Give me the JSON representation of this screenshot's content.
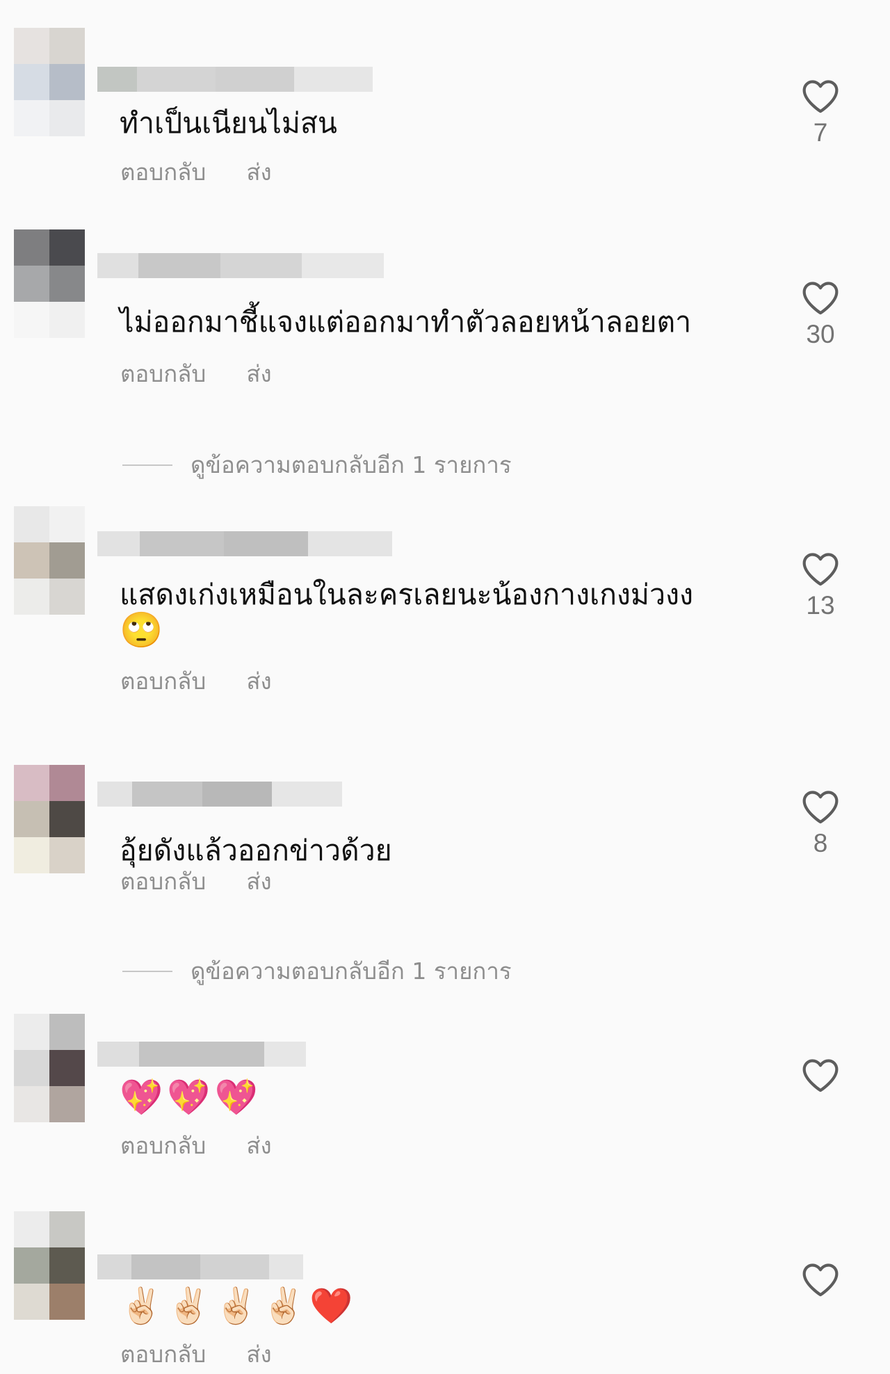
{
  "comments": [
    {
      "text": "ทำเป็นเนียนไม่สน",
      "emojis": "",
      "reply_label": "ตอบกลับ",
      "send_label": "ส่ง",
      "likes": "7",
      "more_replies": ""
    },
    {
      "text": "ไม่ออกมาชี้แจงแต่ออกมาทำตัวลอยหน้าลอยตา",
      "emojis": "",
      "reply_label": "ตอบกลับ",
      "send_label": "ส่ง",
      "likes": "30",
      "more_replies": "ดูข้อความตอบกลับอีก 1 รายการ"
    },
    {
      "text": "แสดงเก่งเหมือนในละครเลยนะน้องกางเกงม่วงง",
      "emojis": "🙄",
      "reply_label": "ตอบกลับ",
      "send_label": "ส่ง",
      "likes": "13",
      "more_replies": ""
    },
    {
      "text": "อุ้ยดังแล้วออกข่าวด้วย",
      "emojis": "",
      "reply_label": "ตอบกลับ",
      "send_label": "ส่ง",
      "likes": "8",
      "more_replies": "ดูข้อความตอบกลับอีก 1 รายการ"
    },
    {
      "text": "",
      "emojis": "💖💖💖",
      "reply_label": "ตอบกลับ",
      "send_label": "ส่ง",
      "likes": "",
      "more_replies": ""
    },
    {
      "text": "",
      "emojis": "✌🏻✌🏻✌🏻✌🏻❤️",
      "reply_label": "ตอบกลับ",
      "send_label": "ส่ง",
      "likes": "",
      "more_replies": ""
    }
  ]
}
